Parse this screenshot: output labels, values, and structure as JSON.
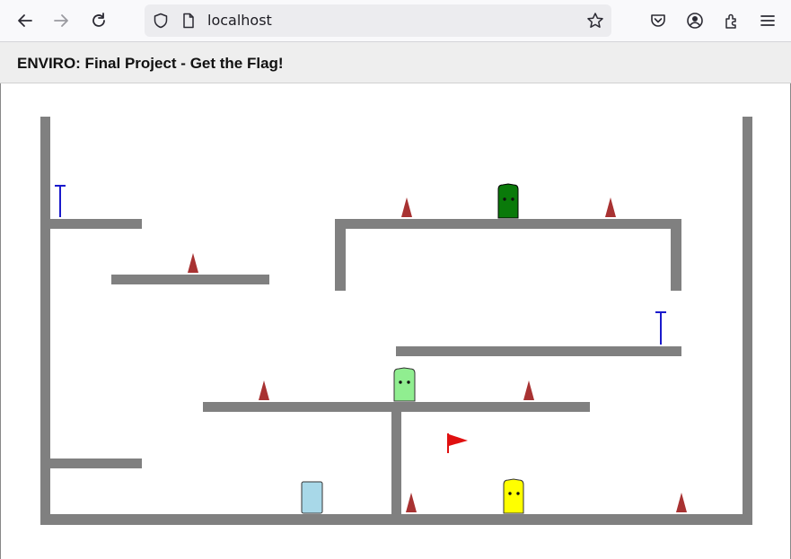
{
  "browser": {
    "url": "localhost",
    "icons": [
      "back-arrow-icon",
      "forward-arrow-icon",
      "reload-icon",
      "shield-icon",
      "page-icon",
      "star-icon",
      "pocket-icon",
      "account-icon",
      "extensions-icon",
      "menu-icon"
    ]
  },
  "page": {
    "title": "ENVIRO: Final Project - Get the Flag!"
  },
  "game": {
    "colors": {
      "wall": "#808080",
      "spike": "#a83232",
      "flag": "#e01010",
      "spring": "#1a1acc",
      "player_dark_green": "#0a7a0a",
      "player_light_green": "#90ee90",
      "player_yellow": "#ffff00",
      "player_blue": "#a8d8e8",
      "eye": "#111111"
    }
  }
}
